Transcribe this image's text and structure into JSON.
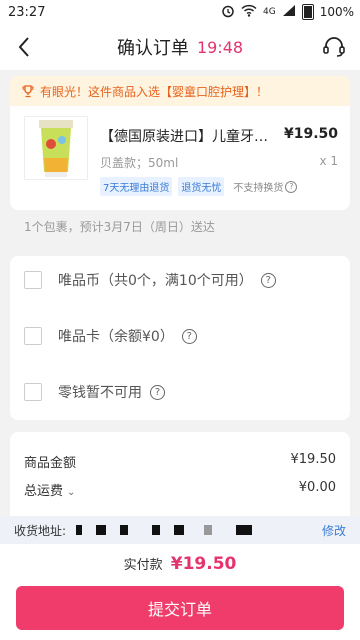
{
  "status_bar": {
    "time": "23:27",
    "network_label": "4G",
    "battery_percent": "100%",
    "icons": [
      "alarm-icon",
      "wifi-icon",
      "signal-icon",
      "battery-icon"
    ]
  },
  "header": {
    "title": "确认订单",
    "countdown": "19:48",
    "icons": [
      "back-icon",
      "customer-service-icon"
    ]
  },
  "banner": {
    "text": "有眼光！这件商品入选【婴童口腔护理】！",
    "icon": "trophy-icon"
  },
  "product": {
    "title": "【德国原装进口】儿童牙膏…",
    "price": "¥19.50",
    "spec": "贝盖款；50ml",
    "quantity": "x 1",
    "tags": [
      "7天无理由退货",
      "退货无忧",
      "不支持换货"
    ]
  },
  "delivery": {
    "text": "1个包裹，预计3月7日（周日）送达"
  },
  "payment_options": [
    {
      "label": "唯品币（共0个，满10个可用）"
    },
    {
      "label": "唯品卡（余额¥0）"
    },
    {
      "label": "零钱暂不可用"
    }
  ],
  "summary": {
    "goods_amount_label": "商品金额",
    "goods_amount_value": "¥19.50",
    "rebate_label": "总运费",
    "rebate_value": "¥0.00"
  },
  "address": {
    "label": "收货地址:",
    "edit_label": "修改"
  },
  "footer": {
    "total_label": "实付款",
    "total_value": "¥19.50",
    "submit_label": "提交订单"
  },
  "colors": {
    "accent": "#f03c6a",
    "timer": "#e5336d",
    "banner_bg": "#fff4e0",
    "banner_text": "#e8621c",
    "link": "#3a7bd5"
  }
}
